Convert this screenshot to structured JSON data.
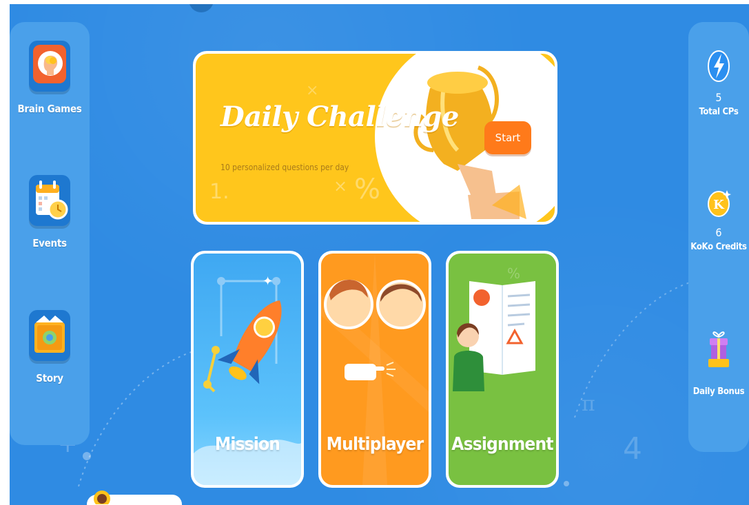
{
  "left_nav": {
    "items": [
      {
        "label": "Brain Games",
        "icon": "brain-head-icon"
      },
      {
        "label": "Events",
        "icon": "calendar-clock-icon"
      },
      {
        "label": "Story",
        "icon": "open-book-icon"
      }
    ]
  },
  "daily_challenge": {
    "title": "Daily Challenge",
    "subtitle": "10 personalized questions per day",
    "start_label": "Start",
    "icon": "trophy-icon"
  },
  "modes": [
    {
      "label": "Mission",
      "icon": "rocket-icon",
      "color": "#4db3f7"
    },
    {
      "label": "Multiplayer",
      "icon": "two-players-icon",
      "color": "#ff9a1f"
    },
    {
      "label": "Assignment",
      "icon": "teacher-book-icon",
      "color": "#7cc242"
    }
  ],
  "stats": {
    "total_cps": {
      "value": "5",
      "label": "Total CPs",
      "icon": "lightning-icon"
    },
    "koko_credits": {
      "value": "6",
      "label": "KoKo Credits",
      "icon": "koko-coin-icon"
    },
    "daily_bonus": {
      "label": "Daily Bonus",
      "icon": "gift-box-icon"
    }
  },
  "colors": {
    "background": "#2f8be3",
    "panel": "#4aa0ea",
    "challenge": "#ffc61c",
    "start": "#ff7a1a"
  }
}
